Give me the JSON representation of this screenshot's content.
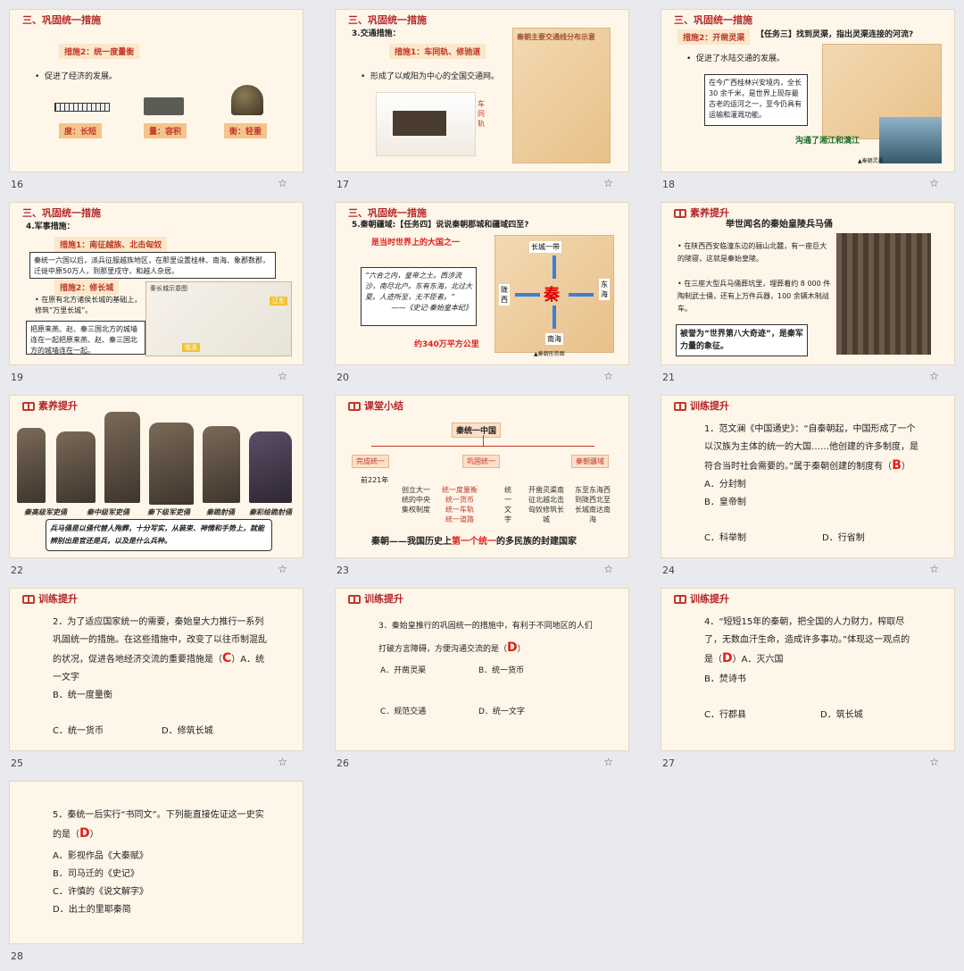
{
  "slides": [
    {
      "num": "16",
      "title": "三、巩固统一措施",
      "tag": "措施2：统一度量衡",
      "bullet": "促进了经济的发展。",
      "labels": [
        "度：长短",
        "量：容积",
        "衡：轻重"
      ]
    },
    {
      "num": "17",
      "title": "三、巩固统一措施",
      "subtitle": "3.交通措施：",
      "tag": "措施1：车同轨、修驰道",
      "bullet": "形成了以咸阳为中心的全国交通网。",
      "map_title": "秦朝主要交通线分布示意",
      "img_caption": "车同轨"
    },
    {
      "num": "18",
      "title": "三、巩固统一措施",
      "tag": "措施2：开凿灵渠",
      "task": "【任务三】找到灵渠，指出灵渠连接的河流?",
      "bullet": "促进了水陆交通的发展。",
      "box": "在今广西桂林兴安境内，全长30 余千米，是世界上现存最古老的运河之一，至今仍具有运输和灌溉功能。",
      "answer": "沟通了湘江和漓江",
      "credit": "▲秦朝灵渠"
    },
    {
      "num": "19",
      "title": "三、巩固统一措施",
      "subtitle": "4.军事措施：",
      "tag1": "措施1：南征越族、北击匈奴",
      "box1": "秦统一六国以后，派兵征服越族地区，在那里设置桂林、南海、象郡数郡，迁徙中原50万人，到那里戍守，和越人杂居。",
      "tag2": "措施2：修长城",
      "bullet": "在原有北方诸侯长城的基础上，修筑“万里长城”。",
      "box2": "把原来燕、赵、秦三国北方的城墙连在一起把原来燕、赵、秦三国北方的城墙连在一起。",
      "map_title": "秦长城示意图",
      "map_label1": "辽东",
      "map_label2": "临洮"
    },
    {
      "num": "20",
      "title": "三、巩固统一措施",
      "task": "5.秦朝疆域:【任务四】说说秦朝郡城和疆域四至?",
      "highlight": "是当时世界上的大国之一",
      "quote": "“六合之内，皇帝之土。西涉流沙，南尽北户。东有东海，北过大夏。人迹所至，无不臣者。”",
      "quote_source": "——《史记·秦始皇本纪》",
      "area": "约340万平方公里",
      "dirs": [
        "长城一带",
        "陇西",
        "东海",
        "南海",
        "秦"
      ],
      "credit": "▲秦朝形势图"
    },
    {
      "num": "21",
      "title": "素养提升",
      "heading": "举世闻名的秦始皇陵兵马俑",
      "bullet1": "在陕西西安临潼东边的骊山北麓，有一座巨大的陵寝，这就是秦始皇陵。",
      "bullet2": "在三座大型兵马俑葬坑里，埋葬着约 8 000 件陶制武士俑，还有上万件兵器，100 余辆木制战车。",
      "box": "被誉为“世界第八大奇迹”，是秦军力量的象征。"
    },
    {
      "num": "22",
      "title": "素养提升",
      "captions": [
        "秦高级军吏俑",
        "秦中级军吏俑",
        "秦下级军吏俑",
        "秦跪射俑",
        "秦彩绘跪射俑"
      ],
      "box": "兵马俑是以俑代替人殉葬，十分写实，从装束、神情和手势上，就能辨别出是官还是兵，以及是什么兵种。"
    },
    {
      "num": "23",
      "title": "课堂小结",
      "root": "秦统一中国",
      "branches": [
        "完成统一",
        "巩固统一",
        "秦朝疆域"
      ],
      "date": "前221年",
      "col1": "创立大一统的中央集权制度",
      "col2a": "统一度量衡",
      "col2b": "统一货币",
      "col2c": "统一车轨",
      "col2d": "统一道路",
      "col3": "统一文字",
      "col4": "开凿灵渠南征北越北击匈奴修筑长城",
      "col5": "东至东海西到陇西北至长城南达南海",
      "summary_pre": "秦朝——我国历史上",
      "summary_red": "第一个统一",
      "summary_post": "的多民族的封建国家"
    },
    {
      "num": "24",
      "title": "训练提升",
      "q": "1．范文澜《中国通史》：“自秦朝起，中国形成了一个以汉族为主体的统一的大国……他创建的许多制度，是符合当时社会需要的。”属于秦朝创建的制度有（",
      "ans": "B",
      "q_end": "）A．分封制",
      "opts": [
        "B．皇帝制",
        "C．科举制",
        "D．行省制"
      ]
    },
    {
      "num": "25",
      "title": "训练提升",
      "q": "2．为了适应国家统一的需要，秦始皇大力推行一系列巩固统一的措施。在这些措施中，改变了以往币制混乱的状况，促进各地经济交流的重要措施是（",
      "ans": "C",
      "q_end": "）A．统一文字",
      "opts": [
        "B．统一度量衡",
        "C．统一货币",
        "D．修筑长城"
      ]
    },
    {
      "num": "26",
      "title": "训练提升",
      "q": "3．秦始皇推行的巩固统一的措施中，有利于不同地区的人们打破方言障碍，方便沟通交流的是（",
      "ans": "D",
      "q_end": "）",
      "opts": [
        "A．开凿灵渠",
        "B．统一货币",
        "C．规范交通",
        "D．统一文字"
      ]
    },
    {
      "num": "27",
      "title": "训练提升",
      "q": "4．“短短15年的秦朝，把全国的人力财力，榨取尽了，无数血汗生命，造成许多事功。”体现这一观点的是（",
      "ans": "D",
      "q_end": "）A．灭六国",
      "opts": [
        "B．焚诗书",
        "C．行郡县",
        "D．筑长城"
      ]
    },
    {
      "num": "28",
      "q": "5．秦统一后实行“书同文”。下列能直接佐证这一史实的是（",
      "ans": "D",
      "q_end": "）",
      "opts": [
        "A．影视作品《大秦赋》",
        "B．司马迁的《史记》",
        "C．许慎的《说文解字》",
        "D．出土的里耶秦简"
      ]
    }
  ],
  "star_icon": "☆"
}
